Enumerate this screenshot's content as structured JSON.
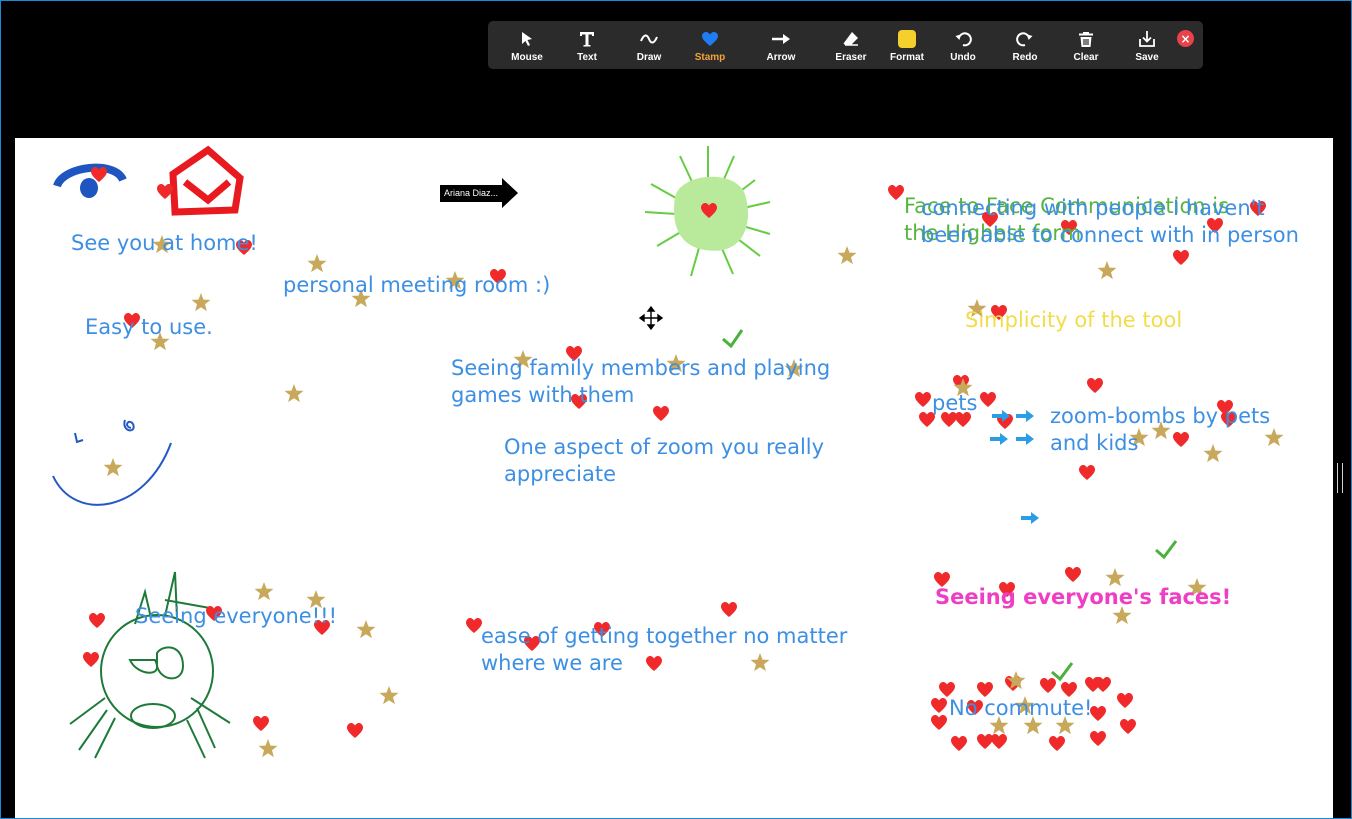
{
  "toolbar": {
    "tools": [
      {
        "label": "Mouse",
        "icon": "cursor-arrow-icon"
      },
      {
        "label": "Text",
        "icon": "text-t-icon"
      },
      {
        "label": "Draw",
        "icon": "draw-wave-icon"
      },
      {
        "label": "Stamp",
        "icon": "heart-stamp-icon",
        "active": true
      },
      {
        "label": "Arrow",
        "icon": "arrow-right-icon"
      },
      {
        "label": "Eraser",
        "icon": "eraser-icon"
      },
      {
        "label": "Format",
        "icon": "format-color-swatch-icon"
      },
      {
        "label": "Undo",
        "icon": "undo-icon"
      },
      {
        "label": "Redo",
        "icon": "redo-icon"
      },
      {
        "label": "Clear",
        "icon": "trash-icon"
      },
      {
        "label": "Save",
        "icon": "save-download-icon"
      }
    ],
    "close_icon": "close-icon",
    "format_color": "#f5cf2c",
    "active_color": "#f2a33a"
  },
  "canvas": {
    "name_tag": "Ariana Diaz...",
    "notes": {
      "see_you_home": "See you at home!",
      "personal_meeting": "personal meeting room :)",
      "easy_to_use": "Easy to use.",
      "seeing_family": "Seeing family members and playing games with them",
      "one_aspect": "One aspect of zoom you really appreciate",
      "face_to_face": "Face to Face Communication is the Highest form",
      "connecting": "connecting with people I haven't been able to connect with in person",
      "simplicity": "Simplicity of the tool",
      "pets": "pets",
      "zoom_bombs": "zoom-bombs by pets and kids",
      "seeing_faces": "Seeing everyone's faces!",
      "seeing_everyone": "Seeing everyone!!!",
      "ease_together": "ease of getting together no matter where we are",
      "no_commute": "No commute!"
    },
    "colors": {
      "blue_text": "#3d8fe3",
      "green_text": "#57b53f",
      "yellow_text": "#f2dc4a",
      "pink_text": "#ee3fc4",
      "heart": "#f02a2a",
      "star": "#c8a85a",
      "check": "#4ab23c",
      "stamp_arrow": "#2a9de8"
    }
  }
}
